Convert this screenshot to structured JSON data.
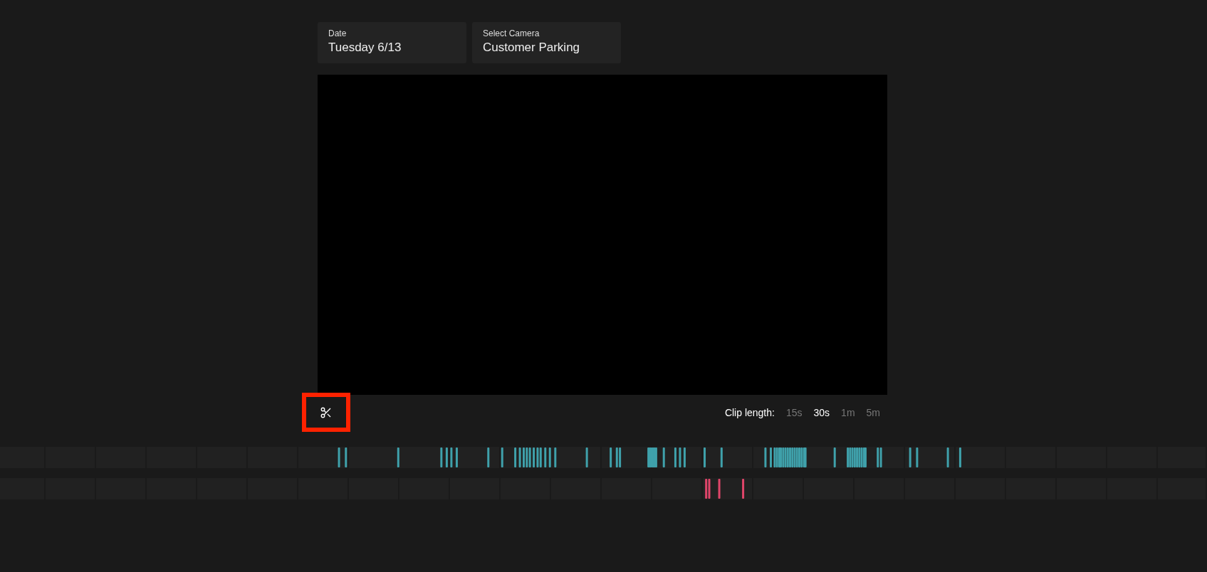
{
  "filters": [
    {
      "label": "Date",
      "value": "Tuesday 6/13"
    },
    {
      "label": "Select Camera",
      "value": "Customer Parking"
    }
  ],
  "clip_length": {
    "label": "Clip length:",
    "options": [
      {
        "label": "15s",
        "selected": false
      },
      {
        "label": "30s",
        "selected": true
      },
      {
        "label": "1m",
        "selected": false
      },
      {
        "label": "5m",
        "selected": false
      }
    ]
  },
  "trim_button": {
    "highlighted": true
  }
}
